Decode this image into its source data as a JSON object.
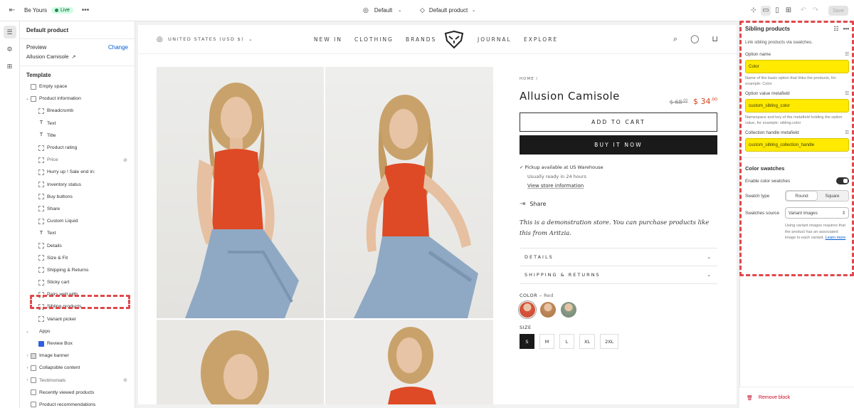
{
  "topbar": {
    "store_name": "Be Yours",
    "status": "Live",
    "theme_selector": "Default",
    "template_selector": "Default product",
    "save_label": "Save"
  },
  "left_panel": {
    "title": "Default product",
    "preview_label": "Preview",
    "change_label": "Change",
    "product_name": "Allusion Camisole",
    "template_label": "Template",
    "tree": [
      {
        "label": "Empty space",
        "level": 1,
        "icon": "section",
        "chevron": false
      },
      {
        "label": "Product information",
        "level": 1,
        "icon": "section",
        "chevron": "open"
      },
      {
        "label": "Breadcrumb",
        "level": 2,
        "icon": "block"
      },
      {
        "label": "Text",
        "level": 2,
        "icon": "text"
      },
      {
        "label": "Title",
        "level": 2,
        "icon": "text"
      },
      {
        "label": "Product rating",
        "level": 2,
        "icon": "block"
      },
      {
        "label": "Price",
        "level": 2,
        "icon": "block",
        "hidden": true
      },
      {
        "label": "Hurry up ! Sale end in:",
        "level": 2,
        "icon": "block"
      },
      {
        "label": "Inventory status",
        "level": 2,
        "icon": "block"
      },
      {
        "label": "Buy buttons",
        "level": 2,
        "icon": "block"
      },
      {
        "label": "Share",
        "level": 2,
        "icon": "block"
      },
      {
        "label": "Custom Liquid",
        "level": 2,
        "icon": "block"
      },
      {
        "label": "Text",
        "level": 2,
        "icon": "text"
      },
      {
        "label": "Details",
        "level": 2,
        "icon": "block"
      },
      {
        "label": "Size & Fit",
        "level": 2,
        "icon": "block"
      },
      {
        "label": "Shipping & Returns",
        "level": 2,
        "icon": "block"
      },
      {
        "label": "Sticky cart",
        "level": 2,
        "icon": "block"
      },
      {
        "label": "Pairs well with",
        "level": 2,
        "icon": "block"
      },
      {
        "label": "Sibling products",
        "level": 2,
        "icon": "block",
        "selected": true
      },
      {
        "label": "Variant picker",
        "level": 2,
        "icon": "block"
      },
      {
        "label": "Apps",
        "level": 1,
        "icon": "none",
        "chevron": "open"
      },
      {
        "label": "Review Box",
        "level": 2,
        "icon": "app"
      },
      {
        "label": "Image banner",
        "level": 1,
        "icon": "image",
        "chevron": "closed"
      },
      {
        "label": "Collapsible content",
        "level": 1,
        "icon": "section",
        "chevron": "closed"
      },
      {
        "label": "Testimonials",
        "level": 1,
        "icon": "section",
        "chevron": "closed",
        "hidden": true
      },
      {
        "label": "Recently viewed products",
        "level": 1,
        "icon": "section",
        "chevron": false
      },
      {
        "label": "Product recommendations",
        "level": 1,
        "icon": "section",
        "chevron": false
      }
    ]
  },
  "store": {
    "country": "UNITED STATES (USD $)",
    "nav": [
      "NEW IN",
      "CLOTHING",
      "BRANDS",
      "JOURNAL",
      "EXPLORE"
    ],
    "breadcrumb": "HOME /",
    "product_title": "Allusion Camisole",
    "price_old_main": "$ 68",
    "price_old_cents": ".00",
    "price_new_main": "$ 34",
    "price_new_cents": ".00",
    "add_to_cart": "ADD TO CART",
    "buy_now": "BUY IT NOW",
    "pickup": "Pickup available at US Warehouse",
    "pickup_sub": "Usually ready in 24 hours",
    "store_info": "View store information",
    "share": "Share",
    "description": "This is a demonstration store. You can purchase products like this from Aritzia.",
    "accordions": [
      "DETAILS",
      "SHIPPING & RETURNS"
    ],
    "color_label": "COLOR",
    "color_value": "Red",
    "size_label": "SIZE",
    "sizes": [
      "S",
      "M",
      "L",
      "XL",
      "2XL"
    ],
    "selected_size": "S",
    "accent_color": "#d6451e"
  },
  "right_panel": {
    "title": "Sibling products",
    "description": "Link sibling products via swatches.",
    "option_name_label": "Option name",
    "option_name_value": "Color",
    "option_name_help": "Name of the basis option that links the products, for example: Color",
    "metafield_label": "Option value metafield",
    "metafield_value": "custom_sibling_color",
    "metafield_help": "Namespace and key of the metafield holding the option value, for example: sibling.color",
    "collection_label": "Collection handle metafield",
    "collection_value": "custom_sibling_collection_handle",
    "color_swatches_heading": "Color swatches",
    "enable_label": "Enable color swatches",
    "swatch_type_label": "Swatch type",
    "swatch_round": "Round",
    "swatch_square": "Square",
    "source_label": "Swatches source",
    "source_value": "Variant images",
    "note": "Using variant images requires that the product has an associated image to each variant.",
    "learn_more": "Learn more",
    "remove_block": "Remove block"
  }
}
